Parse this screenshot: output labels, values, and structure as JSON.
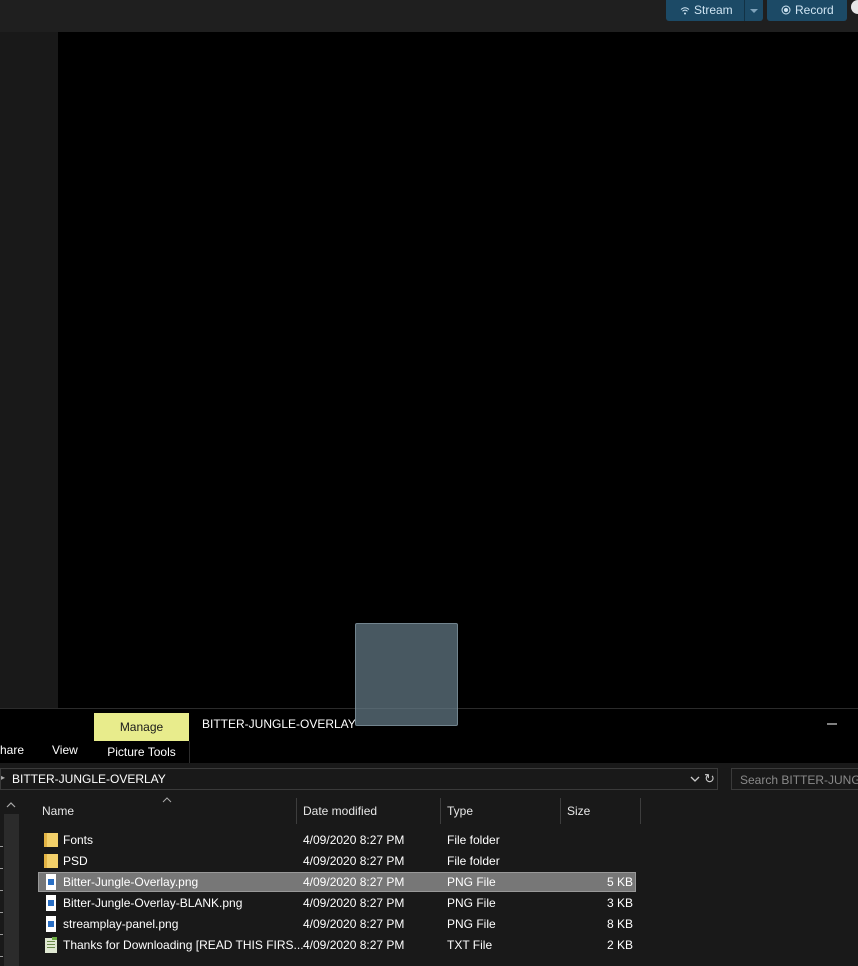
{
  "obs": {
    "stream_label": "Stream",
    "record_label": "Record"
  },
  "explorer": {
    "ribbon_context_tab": "Manage",
    "ribbon_context_group": "Picture Tools",
    "window_title": "BITTER-JUNGLE-OVERLAY",
    "tabs": {
      "share": "hare",
      "view": "View"
    },
    "address": "BITTER-JUNGLE-OVERLAY",
    "search_placeholder": "Search BITTER-JUNGLE",
    "columns": {
      "name": "Name",
      "date": "Date modified",
      "type": "Type",
      "size": "Size"
    },
    "files": [
      {
        "name": "Fonts",
        "date": "4/09/2020 8:27 PM",
        "type": "File folder",
        "size": "",
        "icon": "folder-icon"
      },
      {
        "name": "PSD",
        "date": "4/09/2020 8:27 PM",
        "type": "File folder",
        "size": "",
        "icon": "folder-icon"
      },
      {
        "name": "Bitter-Jungle-Overlay.png",
        "date": "4/09/2020 8:27 PM",
        "type": "PNG File",
        "size": "5 KB",
        "icon": "png-file-icon",
        "selected": true
      },
      {
        "name": "Bitter-Jungle-Overlay-BLANK.png",
        "date": "4/09/2020 8:27 PM",
        "type": "PNG File",
        "size": "3 KB",
        "icon": "png-file-icon"
      },
      {
        "name": "streamplay-panel.png",
        "date": "4/09/2020 8:27 PM",
        "type": "PNG File",
        "size": "8 KB",
        "icon": "png-file-icon"
      },
      {
        "name": "Thanks for Downloading [READ THIS FIRS...",
        "date": "4/09/2020 8:27 PM",
        "type": "TXT File",
        "size": "2 KB",
        "icon": "txt-file-icon"
      }
    ]
  }
}
